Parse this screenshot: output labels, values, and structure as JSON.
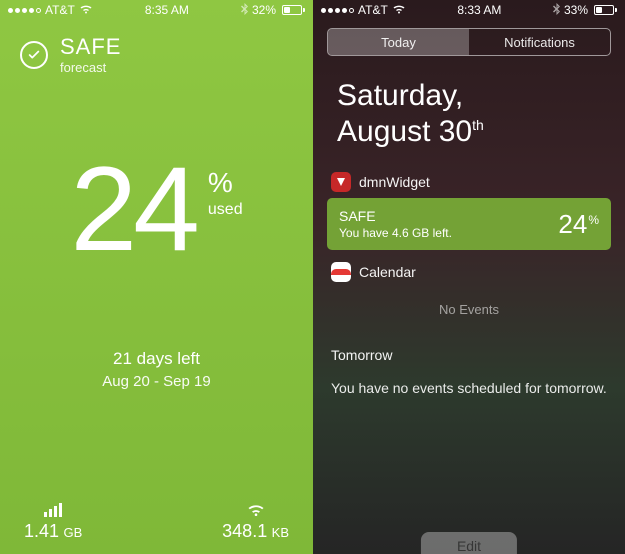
{
  "left": {
    "status": {
      "carrier": "AT&T",
      "time": "8:35 AM",
      "battery_pct": "32%",
      "battery_fill": 32
    },
    "header": {
      "title": "SAFE",
      "subtitle": "forecast"
    },
    "usage": {
      "number": "24",
      "percent_sign": "%",
      "used_label": "used"
    },
    "days": {
      "count": "21",
      "label": "days left",
      "range": "Aug 20 - Sep 19"
    },
    "stats": {
      "cellular": {
        "value": "1.41",
        "unit": "GB"
      },
      "wifi": {
        "value": "348.1",
        "unit": "KB"
      }
    }
  },
  "right": {
    "status": {
      "carrier": "AT&T",
      "time": "8:33 AM",
      "battery_pct": "33%",
      "battery_fill": 33
    },
    "tabs": {
      "today": "Today",
      "notifications": "Notifications"
    },
    "date": {
      "line1": "Saturday,",
      "line2_prefix": "August 30",
      "line2_suffix": "th"
    },
    "widgets": {
      "dmn": {
        "name": "dmnWidget",
        "safe_label": "SAFE",
        "safe_sub": "You have 4.6 GB left.",
        "pct": "24",
        "pct_sign": "%"
      },
      "calendar": {
        "name": "Calendar",
        "no_events": "No Events"
      }
    },
    "tomorrow": {
      "title": "Tomorrow",
      "body": "You have no events scheduled for tomorrow."
    },
    "edit": "Edit"
  }
}
